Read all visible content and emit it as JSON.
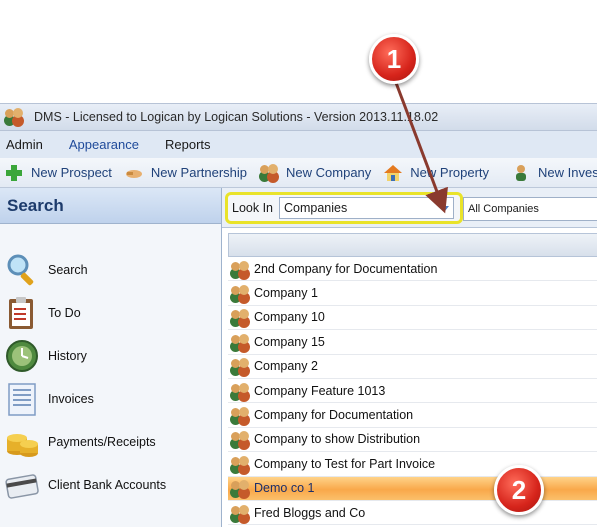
{
  "window": {
    "title": "DMS - Licensed to Logican by Logican Solutions - Version 2013.11.18.02"
  },
  "menu": [
    "Admin",
    "Appearance",
    "Reports"
  ],
  "toolbar": {
    "new_prospect": "New Prospect",
    "new_partnership": "New Partnership",
    "new_company": "New Company",
    "new_property": "New Property",
    "new_inves": "New Inves"
  },
  "sidebar": {
    "header": "Search",
    "items": [
      {
        "label": "Search",
        "icon": "magnifier-icon"
      },
      {
        "label": "To Do",
        "icon": "clipboard-icon"
      },
      {
        "label": "History",
        "icon": "clock-icon"
      },
      {
        "label": "Invoices",
        "icon": "invoice-icon"
      },
      {
        "label": "Payments/Receipts",
        "icon": "coins-icon"
      },
      {
        "label": "Client Bank Accounts",
        "icon": "card-icon"
      }
    ]
  },
  "filter": {
    "look_in_label": "Look In",
    "look_in_value": "Companies",
    "scope_value": "All Companies",
    "highlight_color": "#e9e32a"
  },
  "companies": [
    "2nd Company for Documentation",
    "Company 1",
    "Company 10",
    "Company 15",
    "Company 2",
    "Company Feature 1013",
    "Company for Documentation",
    "Company to show Distribution",
    "Company to Test for Part Invoice",
    "Demo co 1",
    "Fred Bloggs and Co"
  ],
  "selected_company": "Demo co 1",
  "callouts": {
    "one": "1",
    "two": "2",
    "color": "#d6241b"
  }
}
